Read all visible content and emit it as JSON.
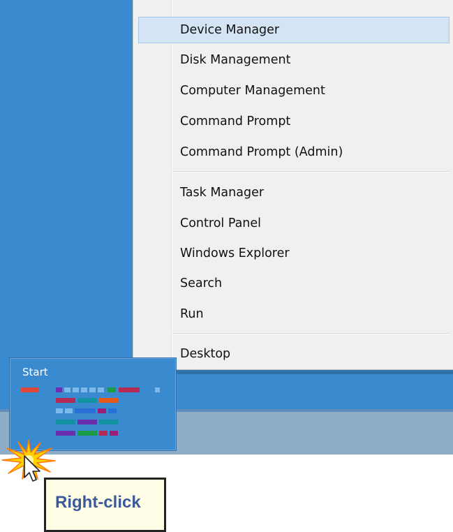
{
  "context_menu": {
    "items": [
      {
        "label": "Device Manager",
        "highlighted": true
      },
      {
        "label": "Disk Management"
      },
      {
        "label": "Computer Management"
      },
      {
        "label": "Command Prompt"
      },
      {
        "label": "Command Prompt (Admin)"
      },
      {
        "label": "Task Manager"
      },
      {
        "label": "Control Panel"
      },
      {
        "label": "Windows Explorer"
      },
      {
        "label": "Search"
      },
      {
        "label": "Run"
      },
      {
        "label": "Desktop"
      }
    ]
  },
  "start": {
    "label": "Start",
    "tile_colors": [
      "#e0483a",
      "#6a2fae",
      "#1b9b47",
      "#7cb8ea",
      "#b52a55",
      "#12939f",
      "#e55a1c",
      "#2a6fd6",
      "#9b1d7a"
    ]
  },
  "callout": {
    "label": "Right-click"
  },
  "colors": {
    "desktop": "#3a8ad0",
    "taskbar": "#8eaec8",
    "menu_background": "#f0f0f0",
    "menu_highlight": "#d4e4f5",
    "callout_text": "#3b5a9a"
  }
}
